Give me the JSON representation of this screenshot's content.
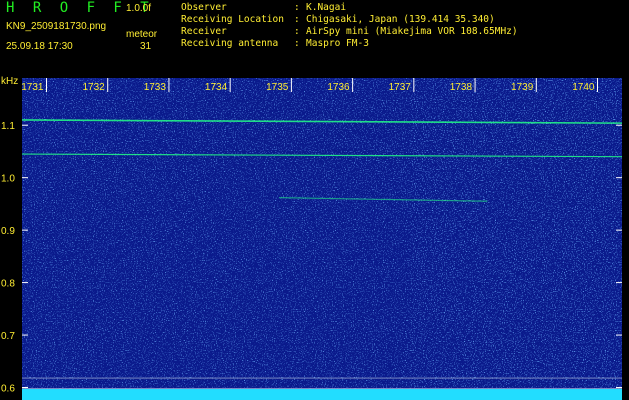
{
  "header": {
    "app_title": "H R O F F T",
    "version": "1.0.0f",
    "filename": "KN9_2509181730.png",
    "datetime": "25.09.18 17:30",
    "meteor_label": "meteor",
    "meteor_count": "31",
    "info": [
      {
        "label": "Observer",
        "value": "K.Nagai"
      },
      {
        "label": "Receiving Location",
        "value": "Chigasaki, Japan (139.414 35.340)"
      },
      {
        "label": "Receiver",
        "value": "AirSpy mini (Miakejima VOR 108.65MHz)"
      },
      {
        "label": "Receiving antenna",
        "value": "Maspro FM-3"
      }
    ]
  },
  "colors": {
    "background": "#000000",
    "text": "#ffee33",
    "title": "#22ee22",
    "spectrogram_base": "#0a1a8c",
    "signal": "#22ff88",
    "noise_floor": "#22ddff"
  },
  "chart_data": {
    "type": "heatmap",
    "ylabel": "kHz",
    "x_ticks": [
      "1731",
      "1732",
      "1733",
      "1734",
      "1735",
      "1736",
      "1737",
      "1738",
      "1739",
      "1740"
    ],
    "y_ticks": [
      "1.1",
      "1.0",
      "0.9",
      "0.8",
      "0.7",
      "0.6"
    ],
    "ylim": [
      0.58,
      1.19
    ],
    "xlim": [
      1730.6,
      1740.4
    ],
    "traces": [
      {
        "x": [
          1730.6,
          1740.4
        ],
        "y": [
          1.11,
          1.104
        ]
      },
      {
        "x": [
          1730.6,
          1740.4
        ],
        "y": [
          1.045,
          1.04
        ]
      },
      {
        "x": [
          1734.8,
          1738.2
        ],
        "y": [
          0.962,
          0.955
        ]
      }
    ],
    "horizontal_lines_khz": [
      0.618,
      0.598
    ],
    "grid": false
  }
}
